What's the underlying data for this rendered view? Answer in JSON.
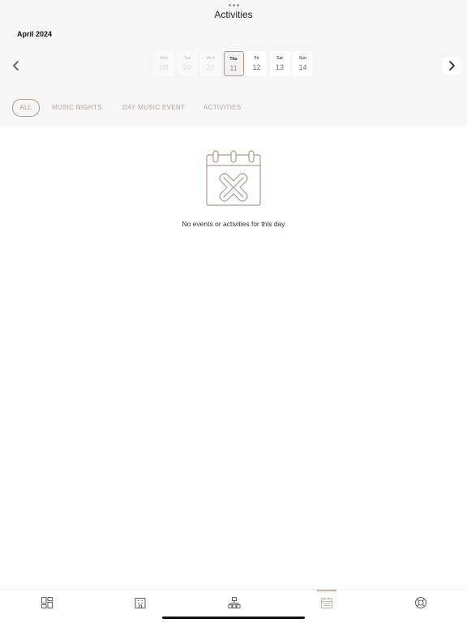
{
  "header": {
    "title": "Activities",
    "month": "April 2024"
  },
  "navigation": {
    "prev_icon": "chevron-left-icon",
    "next_icon": "chevron-right-icon"
  },
  "days": [
    {
      "name": "Mon",
      "date": "08",
      "state": "past"
    },
    {
      "name": "Tue",
      "date": "09",
      "state": "past"
    },
    {
      "name": "Wed",
      "date": "10",
      "state": "past"
    },
    {
      "name": "Thu",
      "date": "11",
      "state": "selected"
    },
    {
      "name": "Fri",
      "date": "12",
      "state": "upcoming"
    },
    {
      "name": "Sat",
      "date": "13",
      "state": "upcoming"
    },
    {
      "name": "Sun",
      "date": "14",
      "state": "upcoming"
    }
  ],
  "filters": [
    {
      "label": "ALL",
      "active": true
    },
    {
      "label": "MUSIC NIGHTS",
      "active": false
    },
    {
      "label": "DAY MUSIC EVENT",
      "active": false
    },
    {
      "label": "ACTIVITIES",
      "active": false
    }
  ],
  "empty_state": {
    "icon": "calendar-cancel-icon",
    "message": "No events or activities for this day"
  },
  "tab_bar": {
    "items": [
      {
        "icon": "dashboard-icon",
        "active": false
      },
      {
        "icon": "hotel-building-icon",
        "active": false
      },
      {
        "icon": "organization-icon",
        "active": false
      },
      {
        "icon": "calendar-icon",
        "active": true
      },
      {
        "icon": "lifebuoy-icon",
        "active": false
      }
    ]
  },
  "colors": {
    "accent": "#a99d91",
    "header_bg": "#f6f6f6",
    "text_primary": "#222222",
    "text_muted": "#b3a89c"
  }
}
